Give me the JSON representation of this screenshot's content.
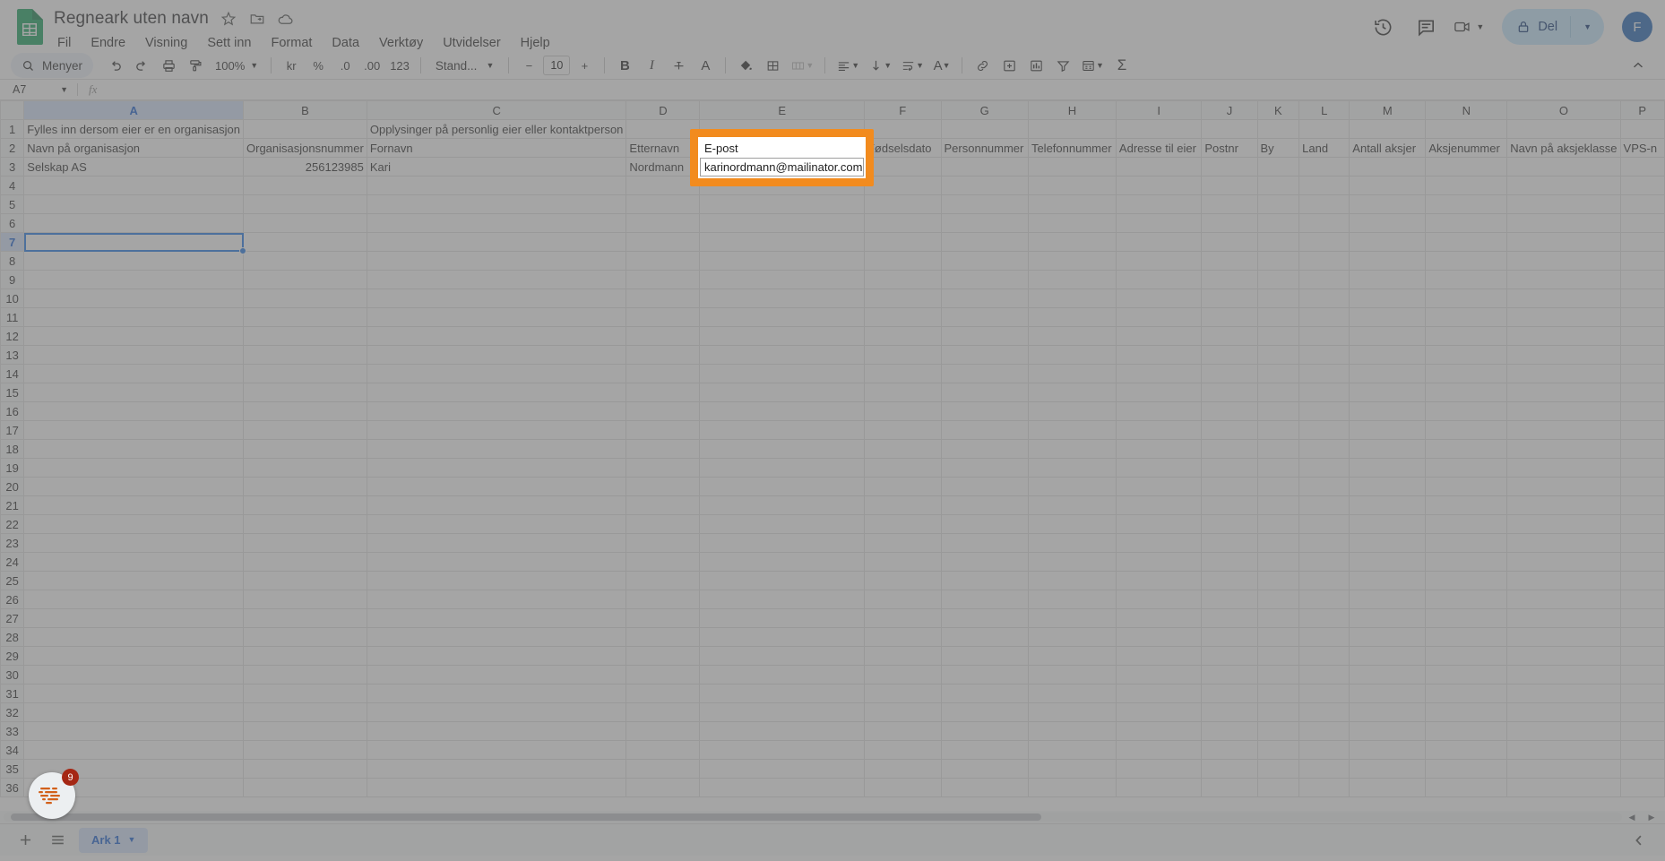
{
  "app": {
    "doc_title": "Regneark uten navn",
    "title_icons": [
      "star-icon",
      "move-to-folder-icon",
      "cloud-saved-icon"
    ],
    "menus": [
      "Fil",
      "Endre",
      "Visning",
      "Sett inn",
      "Format",
      "Data",
      "Verktøy",
      "Utvidelser",
      "Hjelp"
    ],
    "top_right": {
      "history_icon": "version-history-icon",
      "comments_icon": "comment-icon",
      "meet_icon": "meet-camera-icon",
      "share_label": "Del",
      "share_lock_icon": "lock-icon",
      "avatar_initial": "F",
      "avatar_color": "#1a5fb4",
      "share_bg": "#c2e7ff"
    }
  },
  "toolbar": {
    "menyer_label": "Menyer",
    "search_icon": "search-icon",
    "undo": "undo-icon",
    "redo": "redo-icon",
    "print": "print-icon",
    "paint": "paint-format-icon",
    "zoom_value": "100%",
    "currency": "kr",
    "percent": "%",
    "dec_decrease": ".0",
    "dec_increase": ".00",
    "more_formats": "123",
    "font_name": "Stand...",
    "font_size": "10",
    "minus": "−",
    "plus": "+",
    "bold": "B",
    "italic": "I",
    "strikethrough": "S",
    "text_color": "A",
    "fill_color": "fill-color-icon",
    "borders": "borders-icon",
    "merge": "merge-cells-icon",
    "align_h": "align-left-icon",
    "align_v": "align-vertical-icon",
    "text_wrap": "text-wrapping-icon",
    "text_rotation": "text-rotation-icon",
    "link": "insert-link-icon",
    "comment": "insert-comment-icon",
    "chart": "insert-chart-icon",
    "filter": "filter-icon",
    "functions_menu": "functions-icon",
    "sigma": "Σ",
    "collapse": "collapse-toolbar-icon"
  },
  "formula_bar": {
    "name_box": "A7",
    "fx_label": "fx",
    "formula_value": ""
  },
  "grid": {
    "columns": [
      "A",
      "B",
      "C",
      "D",
      "E",
      "F",
      "G",
      "H",
      "I",
      "J",
      "K",
      "L",
      "M",
      "N",
      "O",
      "P"
    ],
    "selected_column": "A",
    "selected_row": 7,
    "selected_cell": "A7",
    "row_count": 36,
    "rows": [
      {
        "n": 1,
        "cells": [
          {
            "col": "A",
            "value": "Fylles inn dersom eier er en organisasjon"
          },
          {
            "col": "C",
            "value": "Opplysinger på personlig eier eller kontaktperson"
          }
        ]
      },
      {
        "n": 2,
        "cells": [
          {
            "col": "A",
            "value": "Navn på organisasjon"
          },
          {
            "col": "B",
            "value": "Organisasjonsnummer"
          },
          {
            "col": "C",
            "value": "Fornavn"
          },
          {
            "col": "D",
            "value": "Etternavn"
          },
          {
            "col": "E",
            "value": "E-post"
          },
          {
            "col": "F",
            "value": "Fødselsdato"
          },
          {
            "col": "G",
            "value": "Personnummer"
          },
          {
            "col": "H",
            "value": "Telefonnummer"
          },
          {
            "col": "I",
            "value": "Adresse til eier"
          },
          {
            "col": "J",
            "value": "Postnr"
          },
          {
            "col": "K",
            "value": "By"
          },
          {
            "col": "L",
            "value": "Land"
          },
          {
            "col": "M",
            "value": "Antall aksjer"
          },
          {
            "col": "N",
            "value": "Aksjenummer"
          },
          {
            "col": "O",
            "value": "Navn på aksjeklasse"
          },
          {
            "col": "P",
            "value": "VPS-n"
          }
        ]
      },
      {
        "n": 3,
        "cells": [
          {
            "col": "A",
            "value": "Selskap AS"
          },
          {
            "col": "B",
            "value": "256123985",
            "align": "right"
          },
          {
            "col": "C",
            "value": "Kari"
          },
          {
            "col": "D",
            "value": "Nordmann"
          },
          {
            "col": "E",
            "value": "karinordmann@mailinator.com"
          }
        ]
      }
    ]
  },
  "callout": {
    "border_color": "#f28b1e",
    "header_value": "E-post",
    "cell_value": "karinordmann@mailinator.com"
  },
  "bottom": {
    "add_sheet_icon": "add-sheet-icon",
    "all_sheets_icon": "all-sheets-icon",
    "sheet_tab_label": "Ark 1",
    "sheet_tab_caret": "chevron-down-icon",
    "explore_icon": "explore-icon",
    "scroll_left_icon": "scroll-left-arrow",
    "scroll_right_icon": "scroll-right-arrow"
  },
  "help_bubble": {
    "badge_count": "9",
    "icon": "help-assistant-icon"
  }
}
